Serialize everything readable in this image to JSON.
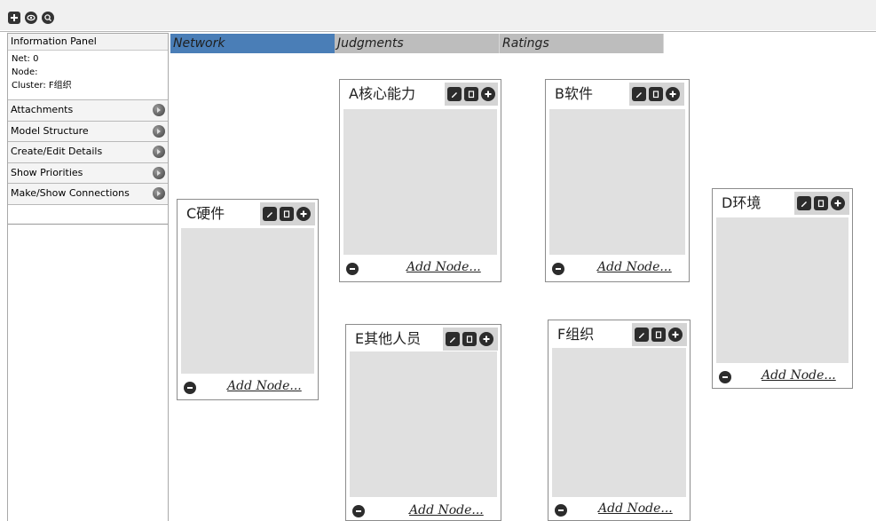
{
  "tabs": [
    {
      "label": "Network",
      "active": true
    },
    {
      "label": "Judgments",
      "active": false
    },
    {
      "label": "Ratings",
      "active": false
    }
  ],
  "toolbar": {
    "icons": [
      "add-icon",
      "view-icon",
      "search-icon"
    ]
  },
  "info_panel": {
    "title": "Information Panel",
    "net": "Net: 0",
    "node": "Node:",
    "cluster": "Cluster: F组织"
  },
  "sections": [
    "Attachments",
    "Model Structure",
    "Create/Edit Details",
    "Show Priorities",
    "Make/Show Connections"
  ],
  "clusters": [
    {
      "name": "A核心能力",
      "add_node": "Add Node..."
    },
    {
      "name": "B软件",
      "add_node": "Add Node..."
    },
    {
      "name": "C硬件",
      "add_node": "Add Node..."
    },
    {
      "name": "D环境",
      "add_node": "Add Node..."
    },
    {
      "name": "E其他人员",
      "add_node": "Add Node..."
    },
    {
      "name": "F组织",
      "add_node": "Add Node..."
    }
  ],
  "colors": {
    "active_tab": "#4a7eb7",
    "inactive_tab": "#bdbdbd",
    "cluster_body": "#e0e0e0",
    "icon_dark": "#2c2c2c"
  }
}
